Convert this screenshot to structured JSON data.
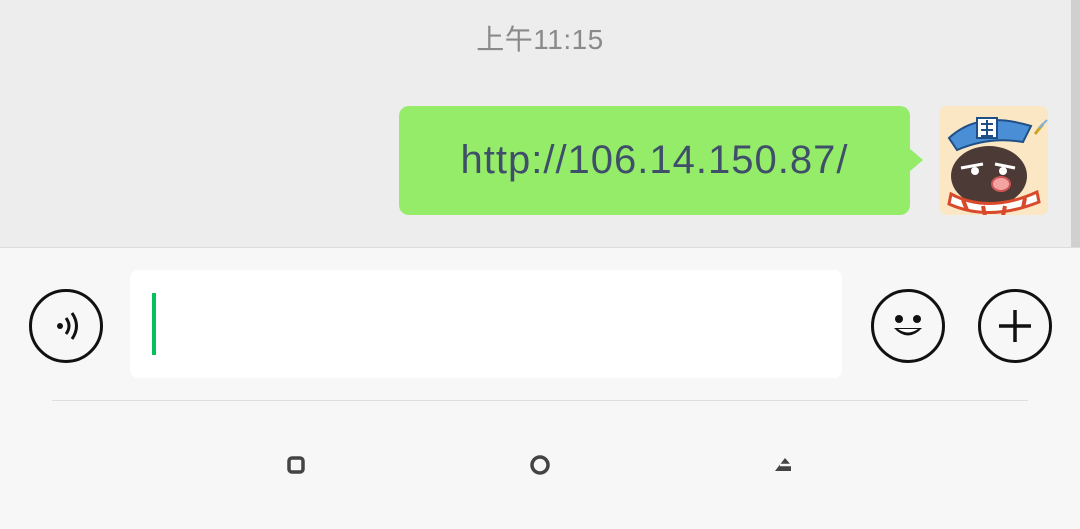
{
  "chat": {
    "timestamp": "上午11:15",
    "messages": [
      {
        "text": "http://106.14.150.87/",
        "sender": "self",
        "avatar_icon": "cartoon-pirate-mushroom-avatar"
      }
    ],
    "colors": {
      "bubble": "#95ec69",
      "background": "#ededed",
      "link_text": "#3f4f6a"
    }
  },
  "input_bar": {
    "value": "",
    "voice_icon": "voice-wave-icon",
    "emoji_icon": "smiley-face-icon",
    "plus_icon": "plus-icon",
    "caret_color": "#07c160"
  },
  "system_nav": {
    "recent_icon": "square-icon",
    "home_icon": "circle-icon",
    "back_icon": "back-triangle-icon"
  }
}
